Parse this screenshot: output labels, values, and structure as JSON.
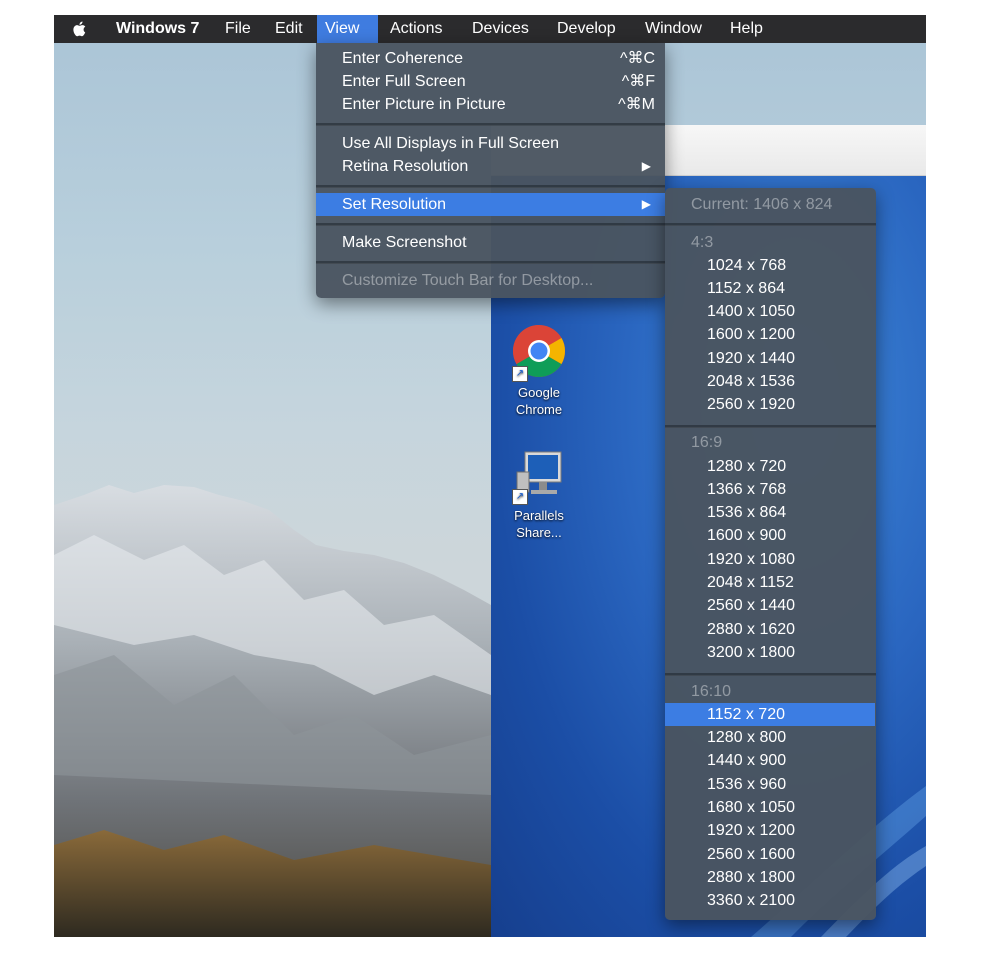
{
  "menubar": {
    "apple": "apple-logo",
    "items": [
      "Windows 7",
      "File",
      "Edit",
      "View",
      "Actions",
      "Devices",
      "Develop",
      "Window",
      "Help"
    ],
    "active": "View"
  },
  "view_menu": {
    "items": [
      {
        "label": "Enter Coherence",
        "shortcut": "^⌘C"
      },
      {
        "label": "Enter Full Screen",
        "shortcut": "^⌘F"
      },
      {
        "label": "Enter Picture in Picture",
        "shortcut": "^⌘M"
      },
      {
        "label": "Use All Displays in Full Screen"
      },
      {
        "label": "Retina Resolution",
        "submenu": "▶"
      },
      {
        "label": "Set Resolution",
        "submenu": "▶"
      },
      {
        "label": "Make Screenshot"
      },
      {
        "label": "Customize Touch Bar for Desktop..."
      }
    ]
  },
  "resolution_menu": {
    "current": "Current: 1406 x 824",
    "groups": [
      {
        "header": "4:3",
        "items": [
          "1024 x 768",
          "1152 x 864",
          "1400 x 1050",
          "1600 x 1200",
          "1920 x 1440",
          "2048 x 1536",
          "2560 x 1920"
        ]
      },
      {
        "header": "16:9",
        "items": [
          "1280 x 720",
          "1366 x 768",
          "1536 x 864",
          "1600 x 900",
          "1920 x 1080",
          "2048 x 1152",
          "2560 x 1440",
          "2880 x 1620",
          "3200 x 1800"
        ]
      },
      {
        "header": "16:10",
        "items": [
          "1152 x 720",
          "1280 x 800",
          "1440 x 900",
          "1536 x 960",
          "1680 x 1050",
          "1920 x 1200",
          "2560 x 1600",
          "2880 x 1800",
          "3360 x 2100"
        ]
      }
    ],
    "highlighted": "1152 x 720"
  },
  "desktop_icons": [
    {
      "icon": "chrome-icon",
      "label": "Google Chrome"
    },
    {
      "icon": "parallels-shared-icon",
      "label": "Parallels Share..."
    }
  ],
  "colors": {
    "menubar": "#2b2b2d",
    "highlight": "#3c7de3",
    "menu_bg": "#4a5460",
    "vm_desktop": "#2a66c0"
  }
}
